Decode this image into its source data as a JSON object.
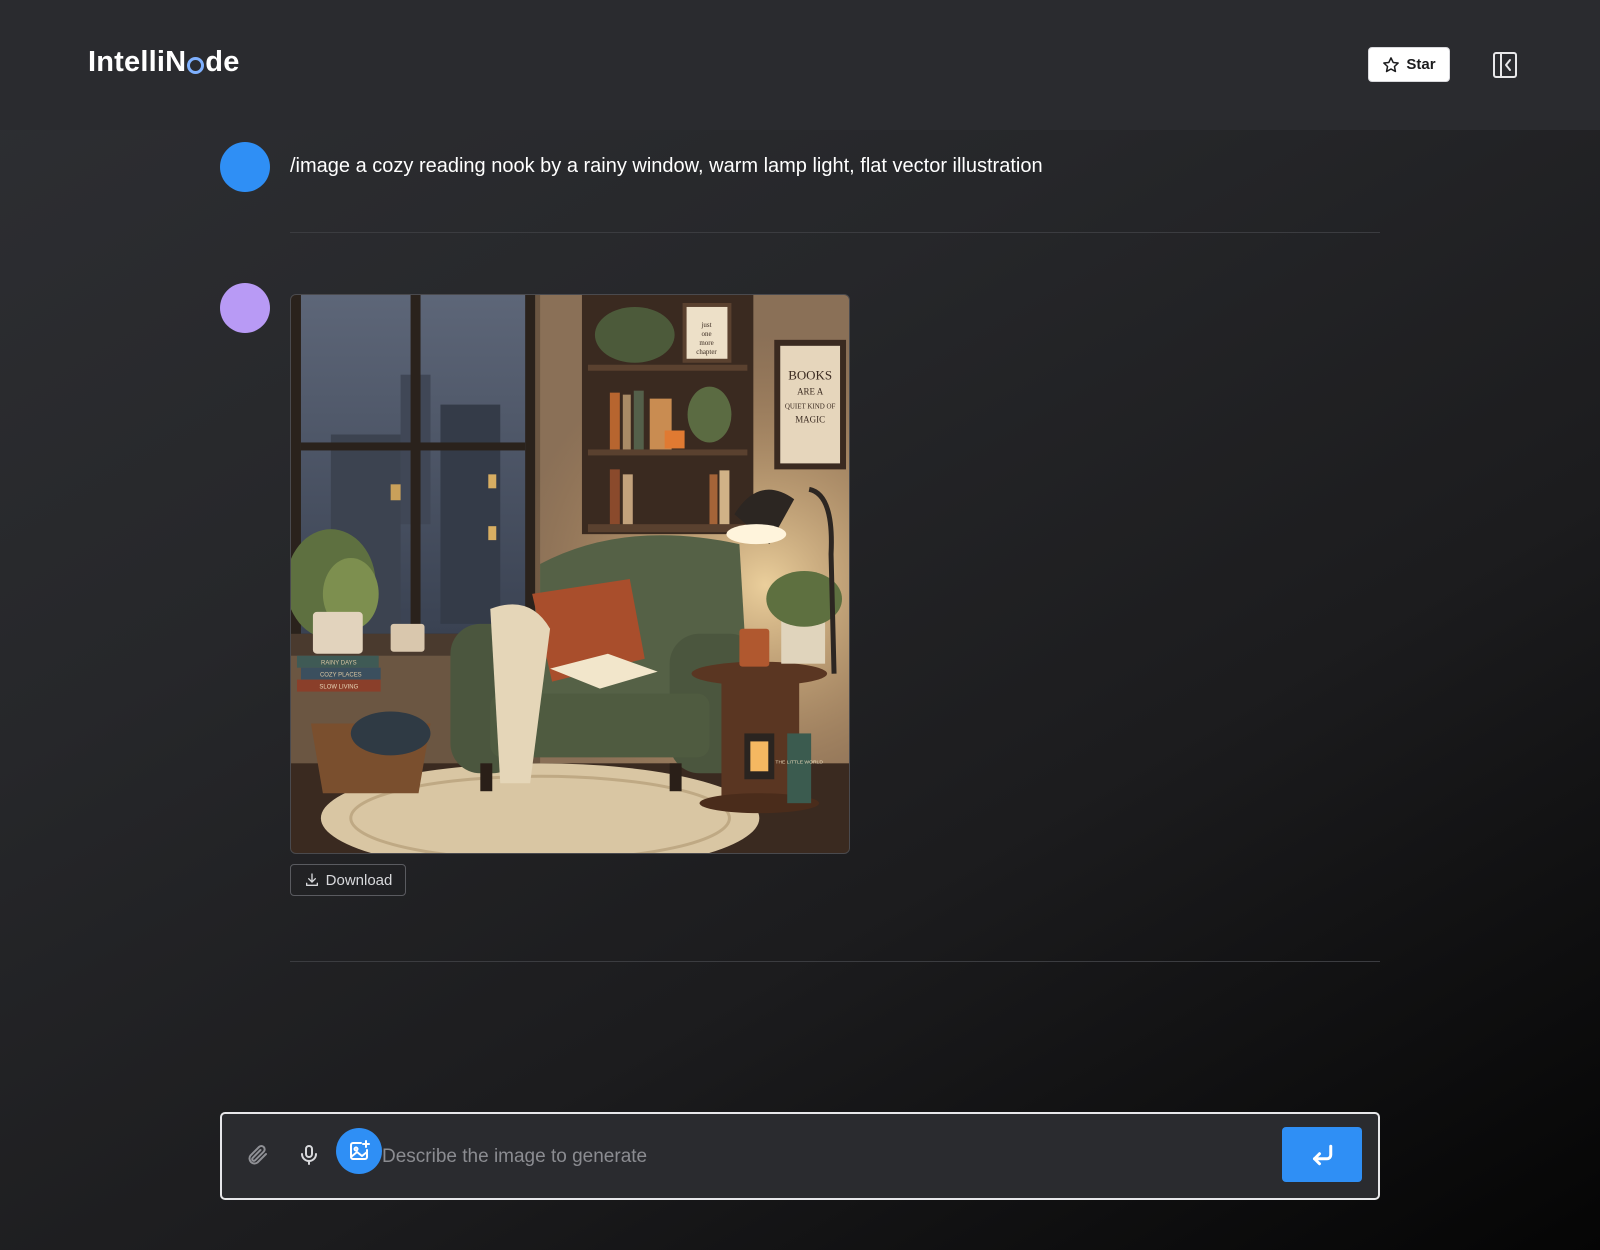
{
  "app": {
    "title_prefix": "IntelliN",
    "title_suffix": "de"
  },
  "header": {
    "star_label": "Star",
    "star_icon": "star-icon",
    "panel_icon": "sidebar-collapse-icon"
  },
  "messages": [
    {
      "role": "user",
      "avatar_color": "#2f8ff5",
      "text": "/image a cozy reading nook by a rainy window, warm lamp light, flat vector illustration"
    },
    {
      "role": "assistant",
      "avatar_color": "#b89af5",
      "image": {
        "subject": "generated-image",
        "sign_line1": "BOOKS",
        "sign_line2": "ARE A",
        "sign_line3": "QUIET KIND OF",
        "sign_line4": "MAGIC",
        "frame_line1": "just",
        "frame_line2": "one",
        "frame_line3": "more",
        "frame_line4": "chapter",
        "book1": "RAINY DAYS",
        "book2": "COZY PLACES",
        "book3": "SLOW LIVING",
        "side_book": "THE LITTLE WORLD"
      },
      "download_label": "Download"
    }
  ],
  "composer": {
    "placeholder": "Describe the image to generate",
    "value": "",
    "attach_icon": "paperclip-icon",
    "mic_icon": "microphone-icon",
    "image_icon": "image-add-icon",
    "send_icon": "enter-icon"
  },
  "colors": {
    "accent": "#2f8ff5",
    "assistant_avatar": "#b89af5",
    "header_bg": "#2a2b2f"
  }
}
